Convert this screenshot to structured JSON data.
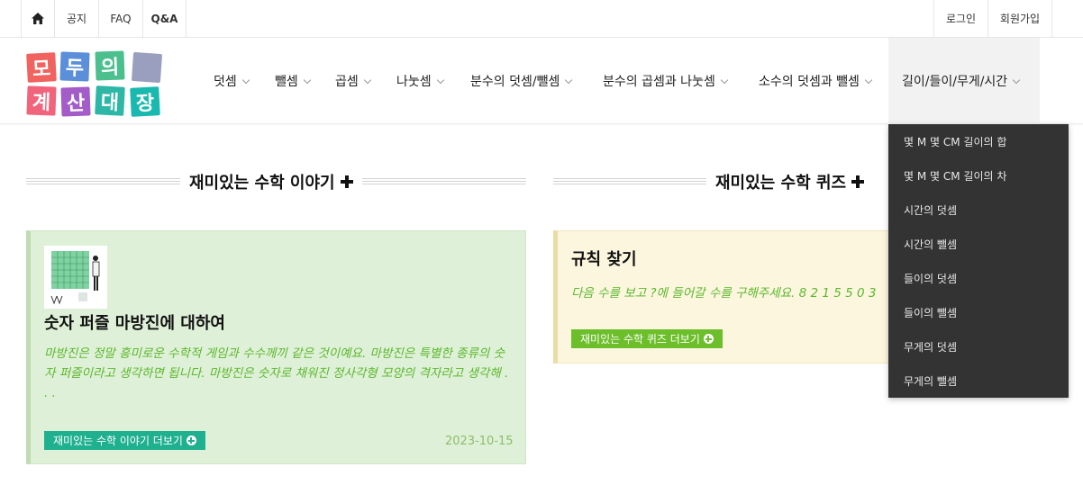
{
  "topbar": {
    "home_label": "home",
    "notice": "공지",
    "faq": "FAQ",
    "qa": "Q&A",
    "login": "로그인",
    "signup": "회원가입"
  },
  "logo": {
    "row1": [
      "모",
      "두",
      "의"
    ],
    "row2": [
      "계",
      "산",
      "대",
      "장"
    ],
    "colors": [
      "#f0635f",
      "#5b8fd9",
      "#4cbf8f",
      "#9b9fbf",
      "#f2637c",
      "#a35cc8",
      "#2eb7a7",
      "#1ab9b0"
    ]
  },
  "nav": {
    "items": [
      {
        "label": "덧셈"
      },
      {
        "label": "뺄셈"
      },
      {
        "label": "곱셈"
      },
      {
        "label": "나눗셈"
      },
      {
        "label": "분수의 덧셈/뺄셈"
      },
      {
        "label": "분수의 곱셈과 나눗셈"
      },
      {
        "label": "소수의 덧셈과 뺄셈"
      },
      {
        "label": "길이/들이/무게/시간"
      }
    ]
  },
  "dropdown": {
    "items": [
      "몇 M 몇 CM 길이의 합",
      "몇 M 몇 CM 길이의 차",
      "시간의 덧셈",
      "시간의 뺄셈",
      "들이의 덧셈",
      "들이의 뺄셈",
      "무게의 덧셈",
      "무게의 뺄셈"
    ]
  },
  "sections": {
    "story": {
      "title": "재미있는 수학 이야기"
    },
    "quiz": {
      "title": "재미있는 수학 퀴즈"
    }
  },
  "story_card": {
    "title": "숫자 퍼즐 마방진에 대하여",
    "desc": "마방진은 정말 흥미로운 수학적 게임과 수수께끼 같은 것이예요. 마방진은 특별한 종류의 숫자 퍼즐이라고 생각하면 됩니다. 마방진은 숫자로 채워진 정사각형 모양의 격자라고 생각해 . . .",
    "button": "재미있는 수학 이야기 더보기",
    "date": "2023-10-15"
  },
  "quiz_card": {
    "title": "규칙 찾기",
    "desc": "다음 수를 보고 ?에 들어갈 수를 구해주세요. 8 2 1 5 5 0 3",
    "button": "재미있는 수학 퀴즈 더보기"
  },
  "colors": {
    "teal_button": "#1fb08f",
    "green_button": "#6cbf2a",
    "dropdown_bg": "#333333",
    "desc_green": "#5cb82e"
  }
}
